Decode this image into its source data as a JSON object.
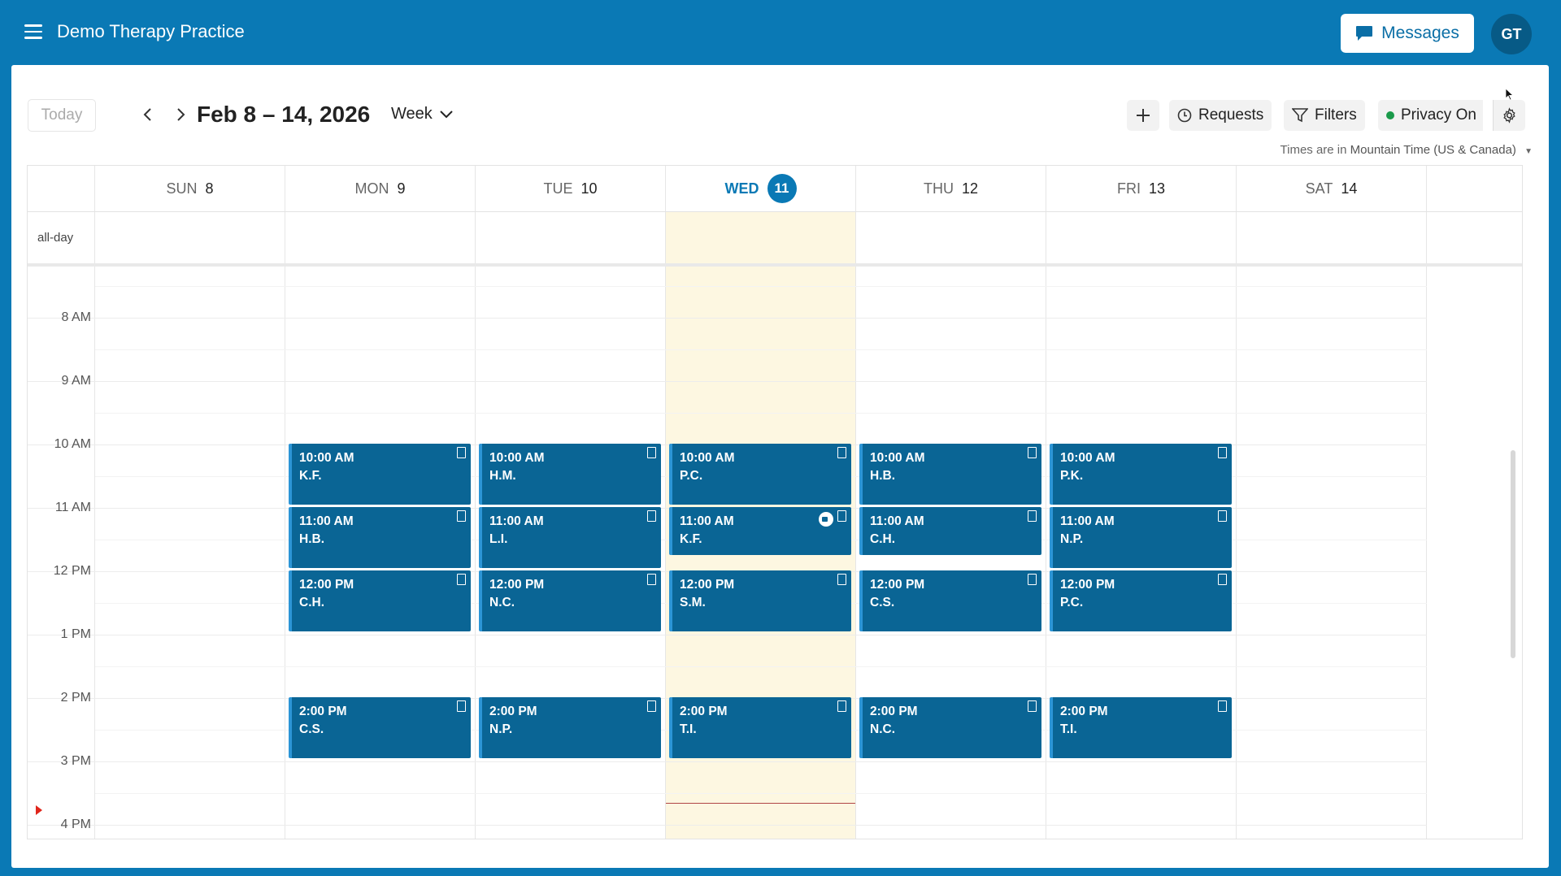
{
  "header": {
    "title": "Demo Therapy Practice",
    "messages_label": "Messages",
    "avatar_initials": "GT"
  },
  "toolbar": {
    "today_label": "Today",
    "date_range": "Feb 8 – 14, 2026",
    "view": "Week",
    "requests_label": "Requests",
    "filters_label": "Filters",
    "privacy_label": "Privacy On",
    "timezone_prefix": "Times are in",
    "timezone": "Mountain Time (US & Canada)"
  },
  "calendar": {
    "allday_label": "all-day",
    "days": [
      {
        "name": "SUN",
        "num": "8"
      },
      {
        "name": "MON",
        "num": "9"
      },
      {
        "name": "TUE",
        "num": "10"
      },
      {
        "name": "WED",
        "num": "11"
      },
      {
        "name": "THU",
        "num": "12"
      },
      {
        "name": "FRI",
        "num": "13"
      },
      {
        "name": "SAT",
        "num": "14"
      }
    ],
    "today_index": 3,
    "time_labels": [
      "8 AM",
      "9 AM",
      "10 AM",
      "11 AM",
      "12 PM",
      "1 PM",
      "2 PM",
      "3 PM",
      "4 PM"
    ],
    "events": [
      {
        "day": 1,
        "time": "10:00 AM",
        "name": "K.F."
      },
      {
        "day": 1,
        "time": "11:00 AM",
        "name": "H.B."
      },
      {
        "day": 1,
        "time": "12:00 PM",
        "name": "C.H."
      },
      {
        "day": 1,
        "time": "2:00 PM",
        "name": "C.S."
      },
      {
        "day": 2,
        "time": "10:00 AM",
        "name": "H.M."
      },
      {
        "day": 2,
        "time": "11:00 AM",
        "name": "L.I."
      },
      {
        "day": 2,
        "time": "12:00 PM",
        "name": "N.C."
      },
      {
        "day": 2,
        "time": "2:00 PM",
        "name": "N.P."
      },
      {
        "day": 3,
        "time": "10:00 AM",
        "name": "P.C."
      },
      {
        "day": 3,
        "time": "11:00 AM",
        "name": "K.F.",
        "video": true,
        "short": true
      },
      {
        "day": 3,
        "time": "12:00 PM",
        "name": "S.M."
      },
      {
        "day": 3,
        "time": "2:00 PM",
        "name": "T.I."
      },
      {
        "day": 4,
        "time": "10:00 AM",
        "name": "H.B."
      },
      {
        "day": 4,
        "time": "11:00 AM",
        "name": "C.H.",
        "short": true
      },
      {
        "day": 4,
        "time": "12:00 PM",
        "name": "C.S."
      },
      {
        "day": 4,
        "time": "2:00 PM",
        "name": "N.C."
      },
      {
        "day": 5,
        "time": "10:00 AM",
        "name": "P.K."
      },
      {
        "day": 5,
        "time": "11:00 AM",
        "name": "N.P."
      },
      {
        "day": 5,
        "time": "12:00 PM",
        "name": "P.C."
      },
      {
        "day": 5,
        "time": "2:00 PM",
        "name": "T.I."
      }
    ]
  }
}
